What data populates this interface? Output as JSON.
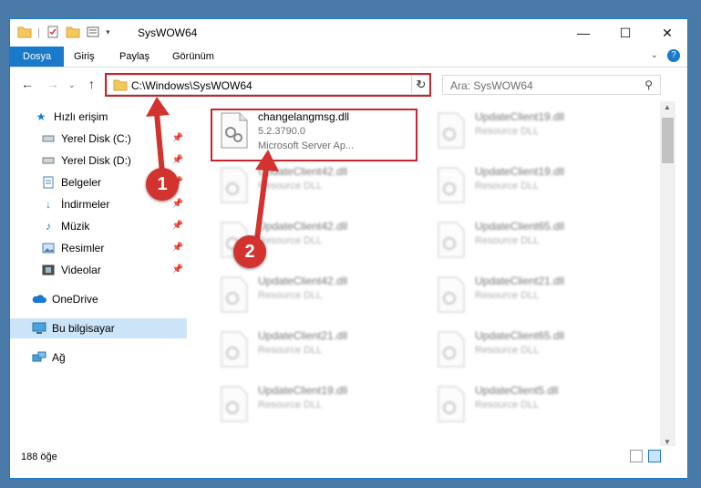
{
  "window": {
    "title": "SysWOW64",
    "min_icon": "minimize-icon",
    "max_icon": "maximize-icon",
    "close_icon": "close-icon"
  },
  "ribbon": {
    "tabs": [
      "Dosya",
      "Giriş",
      "Paylaş",
      "Görünüm"
    ],
    "accent": "#1979ca"
  },
  "address": {
    "path": "C:\\Windows\\SysWOW64",
    "search_placeholder": "Ara: SysWOW64"
  },
  "sidebar": {
    "items": [
      {
        "label": "Hızlı erişim",
        "icon": "star-icon"
      },
      {
        "label": "Yerel Disk (C:)",
        "icon": "drive-icon",
        "pinned": true
      },
      {
        "label": "Yerel Disk (D:)",
        "icon": "drive-icon",
        "pinned": true
      },
      {
        "label": "Belgeler",
        "icon": "documents-icon",
        "pinned": true
      },
      {
        "label": "İndirmeler",
        "icon": "download-icon",
        "pinned": true
      },
      {
        "label": "Müzik",
        "icon": "music-icon",
        "pinned": true
      },
      {
        "label": "Resimler",
        "icon": "pictures-icon",
        "pinned": true
      },
      {
        "label": "Videolar",
        "icon": "videos-icon",
        "pinned": true
      },
      {
        "label": "OneDrive",
        "icon": "cloud-icon"
      },
      {
        "label": "Bu bilgisayar",
        "icon": "computer-icon",
        "selected": true
      },
      {
        "label": "Ağ",
        "icon": "network-icon"
      }
    ]
  },
  "files": {
    "highlighted": {
      "name": "changelangmsg.dll",
      "version": "5.2.3790.0",
      "description": "Microsoft Server Ap..."
    },
    "left_column": [
      {
        "name": "UpdateClient42.dll",
        "desc": "Resource DLL"
      },
      {
        "name": "UpdateClient42.dll",
        "desc": "Resource DLL"
      },
      {
        "name": "UpdateClient42.dll",
        "desc": "Resource DLL"
      },
      {
        "name": "UpdateClient21.dll",
        "desc": "Resource DLL"
      },
      {
        "name": "UpdateClient19.dll",
        "desc": "Resource DLL"
      }
    ],
    "right_column": [
      {
        "name": "UpdateClient19.dll",
        "desc": "Resource DLL"
      },
      {
        "name": "UpdateClient19.dll",
        "desc": "Resource DLL"
      },
      {
        "name": "UpdateClient65.dll",
        "desc": "Resource DLL"
      },
      {
        "name": "UpdateClient21.dll",
        "desc": "Resource DLL"
      },
      {
        "name": "UpdateClient65.dll",
        "desc": "Resource DLL"
      },
      {
        "name": "UpdateClient5.dll",
        "desc": "Resource DLL"
      }
    ]
  },
  "status": {
    "count": "188 öğe"
  },
  "callouts": [
    "1",
    "2"
  ],
  "colors": {
    "highlight": "#c8242c",
    "callout": "#d3332e",
    "selected": "#cce4f7"
  }
}
